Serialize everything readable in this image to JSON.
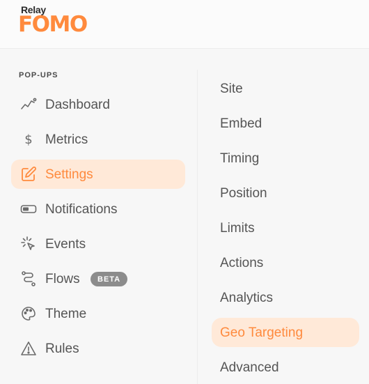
{
  "brand": {
    "top": "Relay",
    "main": "FOMO",
    "color": "#ff8a3d"
  },
  "sidebar": {
    "section_title": "POP-UPS",
    "items": [
      {
        "label": "Dashboard",
        "icon": "trend-line-icon"
      },
      {
        "label": "Metrics",
        "icon": "dollar-icon"
      },
      {
        "label": "Settings",
        "icon": "edit-icon",
        "active": true
      },
      {
        "label": "Notifications",
        "icon": "toggle-icon"
      },
      {
        "label": "Events",
        "icon": "sparkle-cursor-icon"
      },
      {
        "label": "Flows",
        "icon": "flow-icon",
        "badge": "BETA"
      },
      {
        "label": "Theme",
        "icon": "palette-icon"
      },
      {
        "label": "Rules",
        "icon": "warning-icon"
      }
    ]
  },
  "submenu": {
    "items": [
      {
        "label": "Site"
      },
      {
        "label": "Embed"
      },
      {
        "label": "Timing"
      },
      {
        "label": "Position"
      },
      {
        "label": "Limits"
      },
      {
        "label": "Actions"
      },
      {
        "label": "Analytics"
      },
      {
        "label": "Geo Targeting",
        "active": true
      },
      {
        "label": "Advanced"
      }
    ]
  },
  "colors": {
    "accent": "#ff8a3d",
    "active_bg": "#ffe9d8",
    "text": "#555555",
    "badge_bg": "#8c8c8c"
  }
}
